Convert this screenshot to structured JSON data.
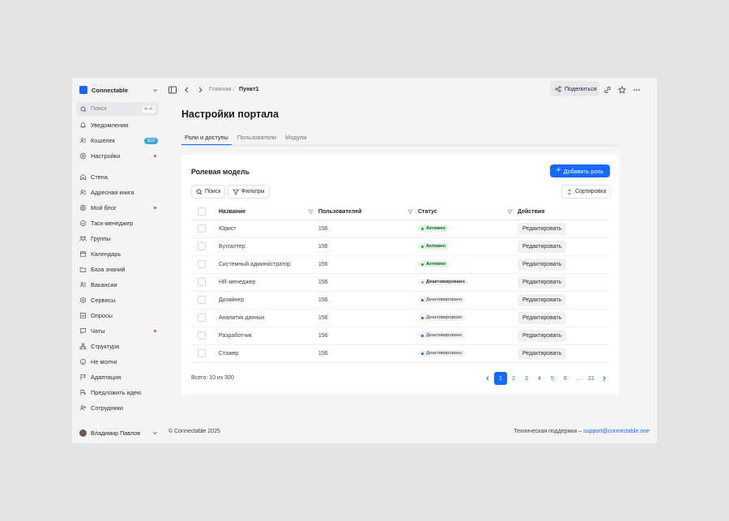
{
  "workspace": {
    "name": "Connectable"
  },
  "search": {
    "placeholder": "Поиск",
    "shortcut": "⌘+K"
  },
  "sidebar": {
    "top_items": [
      {
        "label": "Уведомления",
        "icon": "bell-icon"
      },
      {
        "label": "Кошелек",
        "icon": "users-icon",
        "amount": "$10"
      },
      {
        "label": "Настройки",
        "icon": "gear-icon",
        "dot": true
      }
    ],
    "items": [
      {
        "label": "Стена",
        "icon": "home-icon"
      },
      {
        "label": "Адресная книга",
        "icon": "users-icon"
      },
      {
        "label": "Мой блог",
        "icon": "blog-icon",
        "dot": true
      },
      {
        "label": "Таск-менеджер",
        "icon": "check-circle-icon"
      },
      {
        "label": "Группы",
        "icon": "group-icon"
      },
      {
        "label": "Календарь",
        "icon": "calendar-icon"
      },
      {
        "label": "База знаний",
        "icon": "folder-icon"
      },
      {
        "label": "Вакансии",
        "icon": "users-icon"
      },
      {
        "label": "Сервисы",
        "icon": "hexagon-icon"
      },
      {
        "label": "Опросы",
        "icon": "chart-icon"
      },
      {
        "label": "Чаты",
        "icon": "chat-icon",
        "dot": true
      },
      {
        "label": "Структура",
        "icon": "structure-icon"
      },
      {
        "label": "Не молчи",
        "icon": "smile-icon"
      },
      {
        "label": "Адаптация",
        "icon": "flag-icon"
      },
      {
        "label": "Предложить идею",
        "icon": "flag-plus-icon"
      },
      {
        "label": "Сотрудники",
        "icon": "user-plus-icon"
      }
    ],
    "user": {
      "name": "Владимир Павлов"
    }
  },
  "topbar": {
    "breadcrumbs": [
      "Главная",
      "Пункт1"
    ],
    "share_label": "Поделиться"
  },
  "page": {
    "title": "Настройки портала",
    "tabs": [
      {
        "label": "Роли и доступы",
        "active": true
      },
      {
        "label": "Пользователи",
        "active": false
      },
      {
        "label": "Модули",
        "active": false
      }
    ]
  },
  "card": {
    "title": "Ролевая модель",
    "add_label": "Добавить роль",
    "search_label": "Поиск",
    "filters_label": "Фильтры",
    "sort_label": "Сортировка",
    "columns": [
      "Название",
      "Пользователей",
      "Статус",
      "Действия"
    ],
    "rows": [
      {
        "name": "Юрист",
        "users": "156",
        "status": "Активно",
        "status_type": "green"
      },
      {
        "name": "Бухгалтер",
        "users": "156",
        "status": "Активно",
        "status_type": "green"
      },
      {
        "name": "Системный администратор",
        "users": "156",
        "status": "Активно",
        "status_type": "green"
      },
      {
        "name": "HR-менеджер",
        "users": "156",
        "status": "Деактивировано",
        "status_type": "grey-bold"
      },
      {
        "name": "Дизайнер",
        "users": "156",
        "status": "Деактивировано",
        "status_type": "blue"
      },
      {
        "name": "Аналитик данных",
        "users": "156",
        "status": "Деактивировано",
        "status_type": "blue"
      },
      {
        "name": "Разработчик",
        "users": "156",
        "status": "Деактивировано",
        "status_type": "blue"
      },
      {
        "name": "Стажер",
        "users": "156",
        "status": "Деактивировано",
        "status_type": "blue"
      }
    ],
    "edit_label": "Редактировать",
    "total": "Всего: 10 из 300",
    "pagination": {
      "pages": [
        "1",
        "2",
        "3",
        "4",
        "5",
        "6",
        "...",
        "21"
      ],
      "current": "1"
    }
  },
  "footer": {
    "copyright": "© Connectable 2025",
    "support_label": "Техническая поддержка –",
    "support_email": "support@connectable.one"
  },
  "colors": {
    "accent": "#1768ff",
    "success_bg": "#dff5e3",
    "danger_dot": "#e5484d"
  }
}
